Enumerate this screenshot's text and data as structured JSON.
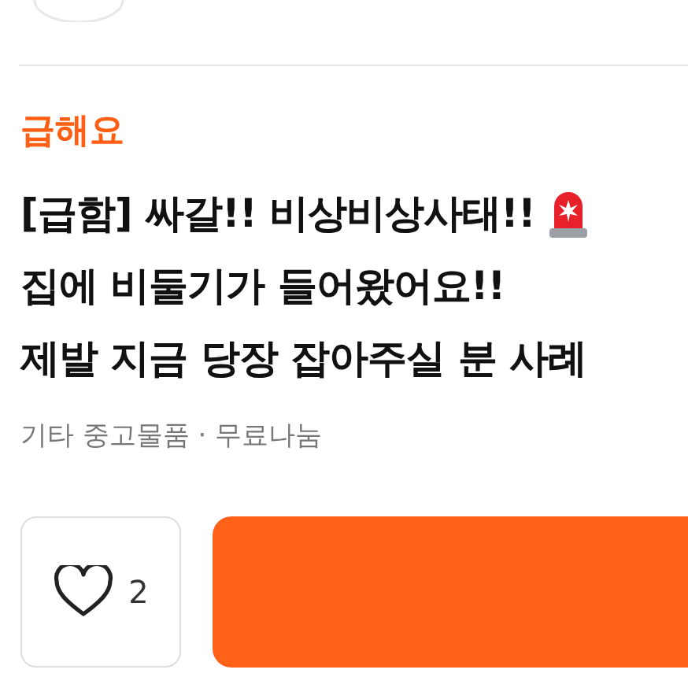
{
  "tag": "급해요",
  "title_lines": [
    {
      "text": "[급함] 싸갈!! 비상비상사태!!",
      "kind": "siren"
    },
    {
      "text": "집에 비둘기가 들어왔어요!!",
      "kind": "plain"
    },
    {
      "text": "제발 지금 당장 잡아주실 분 사례",
      "kind": "plain"
    }
  ],
  "category": "기타 중고물품 · 무료나눔",
  "like": {
    "count": "2",
    "liked": false
  }
}
